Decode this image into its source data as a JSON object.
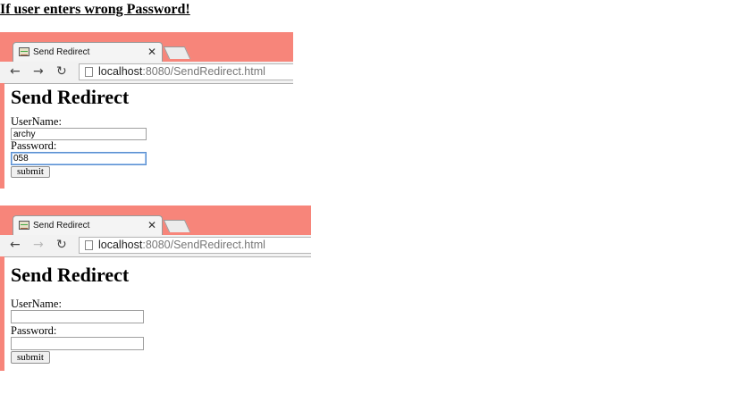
{
  "heading": "If user enters wrong Password!",
  "screens": [
    {
      "tab_title": "Send Redirect",
      "url_host": "localhost",
      "url_rest": ":8080/SendRedirect.html",
      "page_title": "Send Redirect",
      "username_label": "UserName:",
      "username_value": "archy",
      "password_label": "Password:",
      "password_value": "058",
      "submit_label": "submit"
    },
    {
      "tab_title": "Send Redirect",
      "url_host": "localhost",
      "url_rest": ":8080/SendRedirect.html",
      "page_title": "Send Redirect",
      "username_label": "UserName:",
      "username_value": "",
      "password_label": "Password:",
      "password_value": "",
      "submit_label": "submit"
    }
  ],
  "icons": [
    "page-favicon-icon",
    "close-icon",
    "back-arrow-icon",
    "forward-arrow-icon",
    "reload-icon",
    "page-icon"
  ],
  "colors": {
    "browser_frame": "#f7857a",
    "focus_border": "#5a8fd0"
  }
}
